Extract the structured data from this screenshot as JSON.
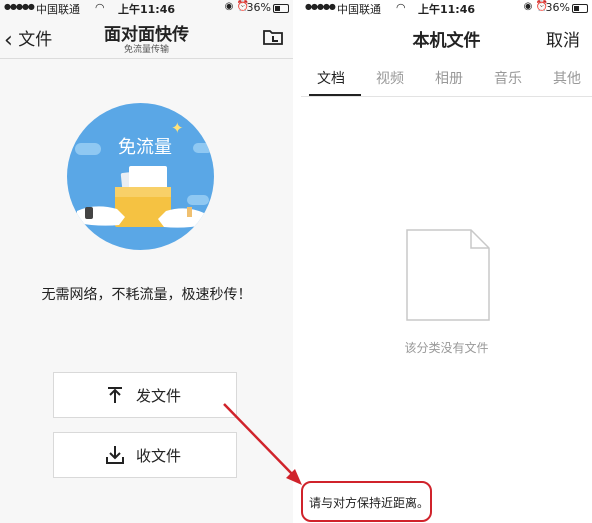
{
  "left_screen": {
    "status": {
      "carrier": "中国联通",
      "time": "上午11:46",
      "battery": "36%"
    },
    "nav": {
      "back_label": "文件",
      "title": "面对面快传",
      "subtitle": "免流量传输",
      "folder_icon": "folder-icon"
    },
    "hero": {
      "badge_text": "免流量"
    },
    "slogan": "无需网络，不耗流量，极速秒传！",
    "buttons": [
      {
        "label": "发文件",
        "icon": "upload-icon"
      },
      {
        "label": "收文件",
        "icon": "download-icon"
      }
    ]
  },
  "right_screen": {
    "status": {
      "carrier": "中国联通",
      "time": "上午11:46",
      "battery": "36%"
    },
    "nav": {
      "title": "本机文件",
      "cancel_label": "取消"
    },
    "tabs": [
      {
        "label": "文档",
        "active": true
      },
      {
        "label": "视频",
        "active": false
      },
      {
        "label": "相册",
        "active": false
      },
      {
        "label": "音乐",
        "active": false
      },
      {
        "label": "其他",
        "active": false
      }
    ],
    "empty_state": {
      "icon": "blank-document-icon",
      "text": "该分类没有文件"
    },
    "hint": "请与对方保持近距离。"
  },
  "colors": {
    "hero_blue": "#5aa7e6",
    "annotation_red": "#d0232b",
    "folder_yellow": "#f5c242"
  }
}
